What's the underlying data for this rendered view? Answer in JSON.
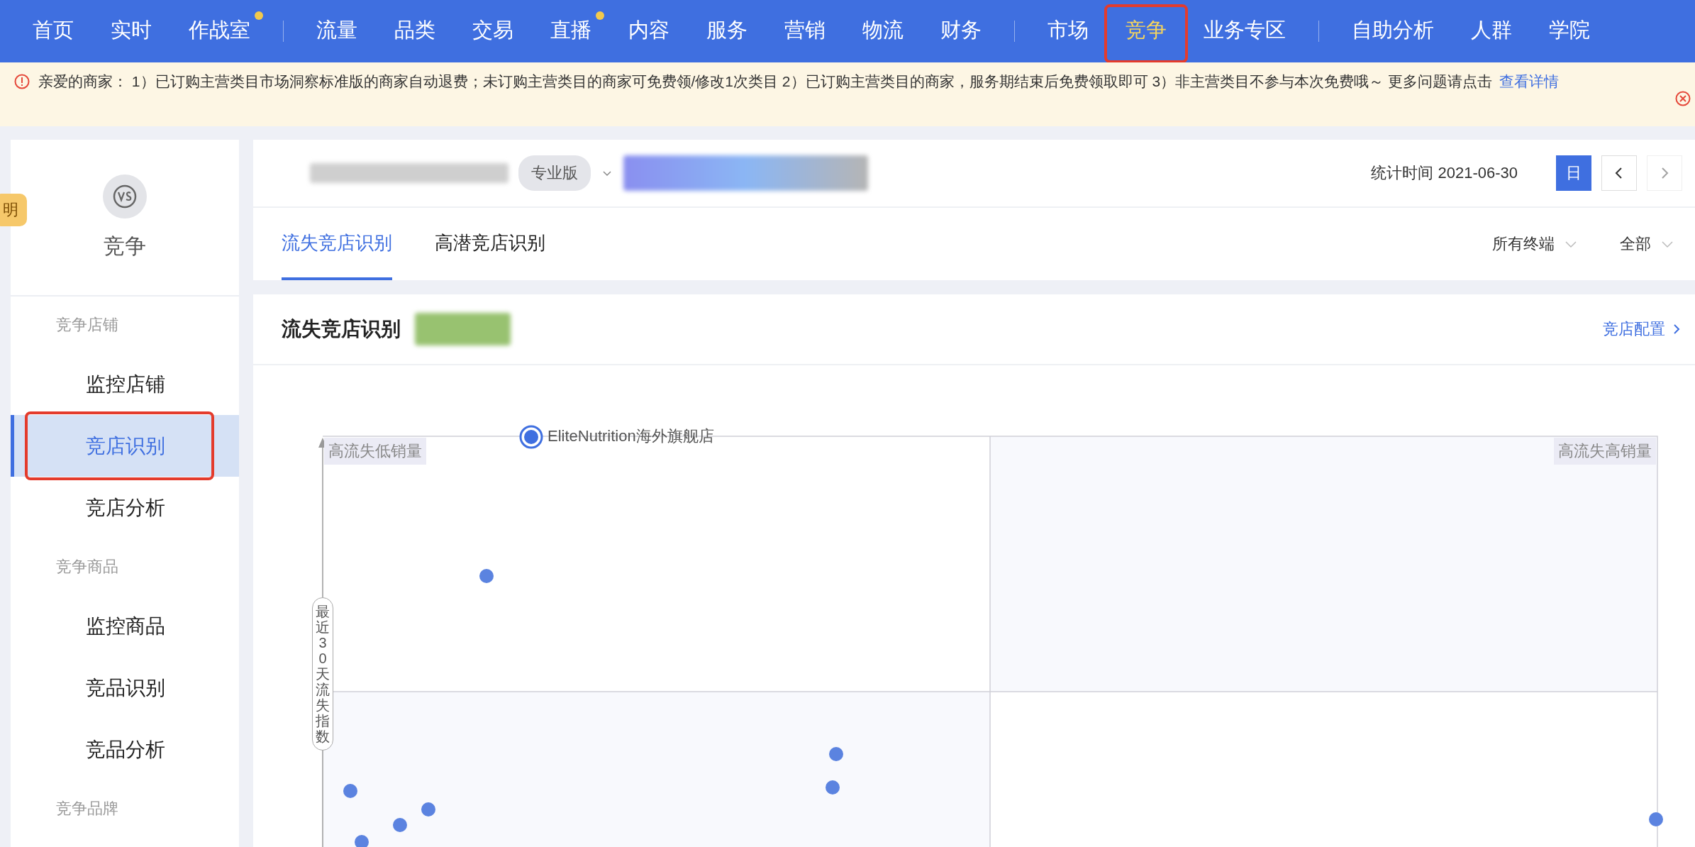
{
  "top_nav": {
    "groups": [
      [
        {
          "label": "首页",
          "selected": false,
          "dot": false
        },
        {
          "label": "实时",
          "selected": false,
          "dot": false
        },
        {
          "label": "作战室",
          "selected": false,
          "dot": true
        }
      ],
      [
        {
          "label": "流量",
          "selected": false,
          "dot": false
        },
        {
          "label": "品类",
          "selected": false,
          "dot": false
        },
        {
          "label": "交易",
          "selected": false,
          "dot": false
        },
        {
          "label": "直播",
          "selected": false,
          "dot": true
        },
        {
          "label": "内容",
          "selected": false,
          "dot": false
        },
        {
          "label": "服务",
          "selected": false,
          "dot": false
        },
        {
          "label": "营销",
          "selected": false,
          "dot": false
        },
        {
          "label": "物流",
          "selected": false,
          "dot": false
        },
        {
          "label": "财务",
          "selected": false,
          "dot": false
        }
      ],
      [
        {
          "label": "市场",
          "selected": false,
          "dot": false
        },
        {
          "label": "竞争",
          "selected": true,
          "dot": false
        },
        {
          "label": "业务专区",
          "selected": false,
          "dot": false
        }
      ],
      [
        {
          "label": "自助分析",
          "selected": false,
          "dot": false
        },
        {
          "label": "人群",
          "selected": false,
          "dot": false
        },
        {
          "label": "学院",
          "selected": false,
          "dot": false
        }
      ]
    ]
  },
  "notice": {
    "text": "亲爱的商家： 1）已订购主营类目市场洞察标准版的商家自动退费；未订购主营类目的商家可免费领/修改1次类目 2）已订购主营类目的商家，服务期结束后免费领取即可 3）非主营类目不参与本次免费哦～ 更多问题请点击",
    "link": "查看详情"
  },
  "floating_badge": "明",
  "sidebar": {
    "title": "竞争",
    "sections": [
      {
        "label": "竞争店铺",
        "items": [
          {
            "label": "监控店铺",
            "selected": false
          },
          {
            "label": "竞店识别",
            "selected": true
          },
          {
            "label": "竞店分析",
            "selected": false
          }
        ]
      },
      {
        "label": "竞争商品",
        "items": [
          {
            "label": "监控商品",
            "selected": false
          },
          {
            "label": "竞品识别",
            "selected": false
          },
          {
            "label": "竞品分析",
            "selected": false
          }
        ]
      },
      {
        "label": "竞争品牌"
      }
    ]
  },
  "header": {
    "edition_tag": "专业版",
    "stat_time": "统计时间 2021-06-30",
    "period_buttons": [
      {
        "label": "日",
        "selected": true
      }
    ]
  },
  "tabs": [
    {
      "label": "流失竞店识别",
      "selected": true
    },
    {
      "label": "高潜竞店识别",
      "selected": false
    }
  ],
  "filters": [
    {
      "label": "所有终端"
    },
    {
      "label": "全部"
    }
  ],
  "panel": {
    "title": "流失竞店识别",
    "config_link": "竞店配置",
    "quadrants": [
      "高流失低销量",
      "高流失高销量"
    ],
    "y_axis_label": "最近30天流失指数",
    "highlighted_point": "EliteNutrition海外旗舰店"
  }
}
